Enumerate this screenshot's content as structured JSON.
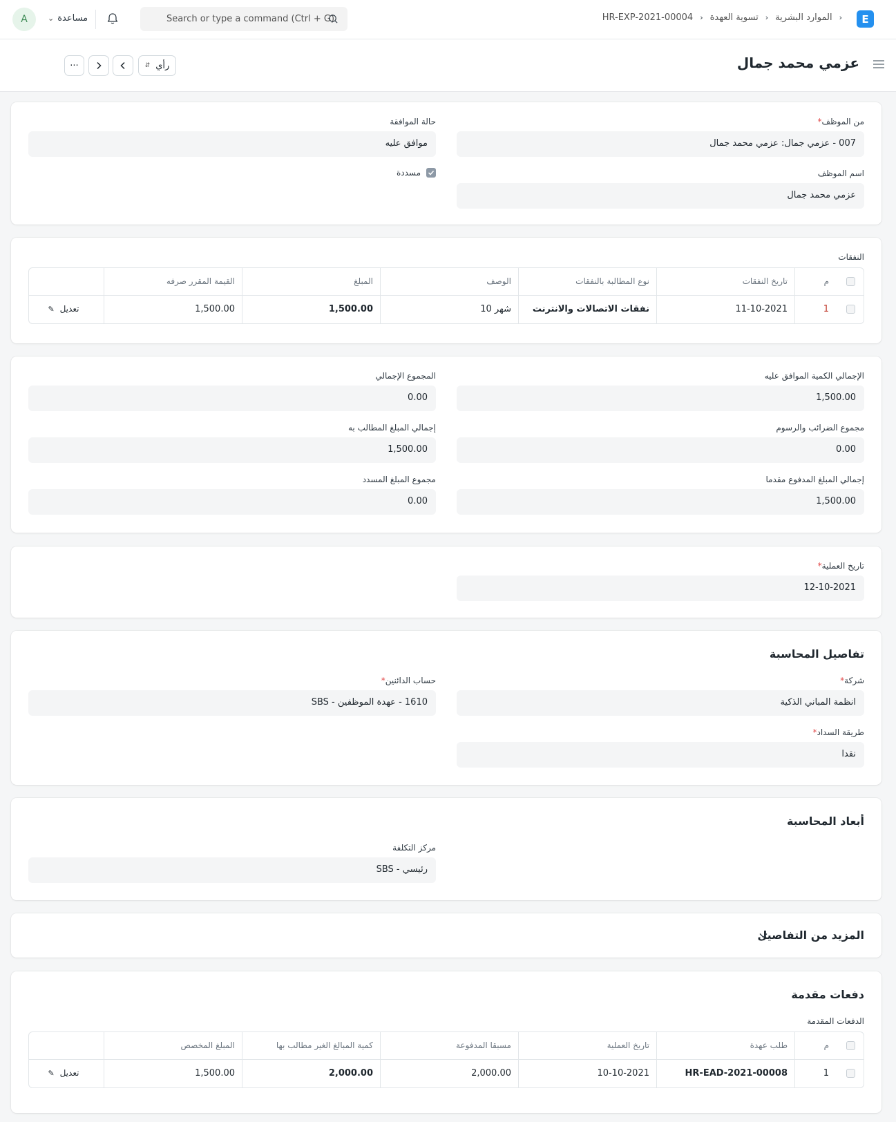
{
  "navbar": {
    "avatar_initial": "A",
    "help_label": "مساعدة",
    "search_placeholder": "Search or type a command (Ctrl + G)",
    "breadcrumbs": [
      "الموارد البشرية",
      "تسوية العهدة",
      "HR-EXP-2021-00004"
    ],
    "logo_letter": "E"
  },
  "page": {
    "title": "عزمي محمد جمال",
    "view_label": "رأي",
    "more_label": "···"
  },
  "employee_section": {
    "from_employee_label": "من الموظف",
    "from_employee_value": "007 - عزمي جمال: عزمي محمد جمال",
    "employee_name_label": "اسم الموظف",
    "employee_name_value": "عزمي محمد جمال",
    "approval_status_label": "حالة الموافقة",
    "approval_status_value": "موافق عليه",
    "paid_label": "مسددة",
    "paid_checked": true
  },
  "expenses": {
    "section_label": "النفقات",
    "columns": [
      "م",
      "تاريخ النفقات",
      "نوع المطالبة بالنفقات",
      "الوصف",
      "المبلغ",
      "القيمة المقرر صرفه"
    ],
    "rows": [
      {
        "idx": "1",
        "date": "11-10-2021",
        "type": "نفقات الاتصالات والانترنت",
        "description": "شهر 10",
        "amount": "1,500.00",
        "sanctioned": "1,500.00"
      }
    ],
    "edit_label": "تعديل"
  },
  "totals": {
    "total_sanctioned_label": "الإجمالي الكمية الموافق عليه",
    "total_sanctioned_value": "1,500.00",
    "grand_total_label": "المجموع الإجمالي",
    "grand_total_value": "0.00",
    "total_taxes_label": "مجموع الضرائب والرسوم",
    "total_taxes_value": "0.00",
    "total_claimed_label": "إجمالي المبلغ المطالب به",
    "total_claimed_value": "1,500.00",
    "total_advance_label": "إجمالي المبلغ المدفوع مقدما",
    "total_advance_value": "1,500.00",
    "total_reimbursed_label": "مجموع المبلغ المسدد",
    "total_reimbursed_value": "0.00"
  },
  "posting": {
    "posting_date_label": "تاريخ العملية",
    "posting_date_value": "12-10-2021"
  },
  "accounting": {
    "title": "تفاصيل المحاسبة",
    "company_label": "شركة",
    "company_value": "انظمة المباني الذكية",
    "payable_account_label": "حساب الدائنين",
    "payable_account_value": "1610 - عهدة الموظفين - SBS",
    "mode_of_payment_label": "طريقة السداد",
    "mode_of_payment_value": "نقدا"
  },
  "dimensions": {
    "title": "أبعاد المحاسبة",
    "cost_center_label": "مركز التكلفة",
    "cost_center_value": "رئيسي - SBS"
  },
  "more_info": {
    "title": "المزيد من التفاصيل"
  },
  "advances": {
    "title": "دفعات مقدمة",
    "table_label": "الدفعات المقدمة",
    "columns": [
      "م",
      "طلب عهدة",
      "تاريخ العملية",
      "مسبقا المدفوعة",
      "كمية المبالغ الغير مطالب بها",
      "المبلغ المخصص"
    ],
    "rows": [
      {
        "idx": "1",
        "employee_advance": "HR-EAD-2021-00008",
        "posting_date": "10-10-2021",
        "advance_paid": "2,000.00",
        "unclaimed_amount": "2,000.00",
        "allocated_amount": "1,500.00"
      }
    ],
    "edit_label": "تعديل"
  },
  "colors": {
    "accent": "#2490ef",
    "required": "#e24c4c",
    "field_bg": "#f4f5f6",
    "avatar_bg": "#e6f4ea"
  }
}
